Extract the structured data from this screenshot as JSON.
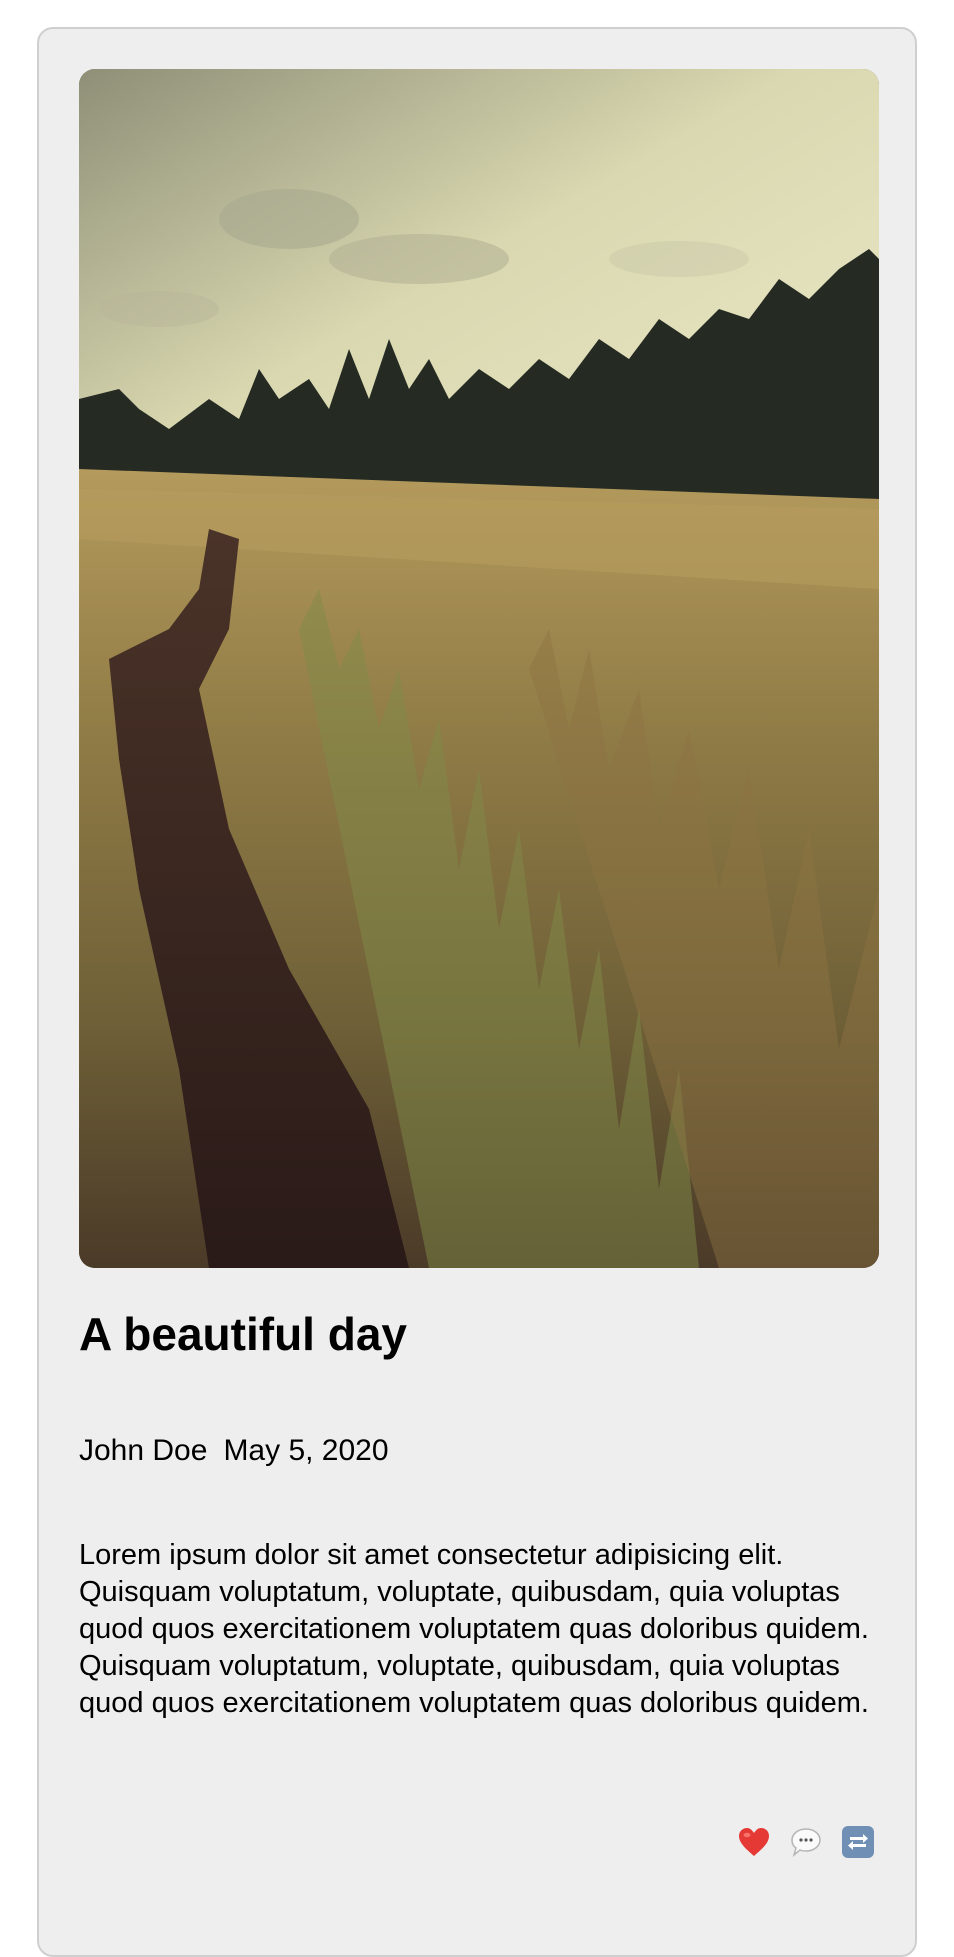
{
  "post": {
    "image_alt": "Grassy meadow with a dirt path and pine forest under a cloudy sky",
    "title": "A beautiful day",
    "author": "John Doe",
    "date": "May 5, 2020",
    "body": "Lorem ipsum dolor sit amet consectetur adipisicing elit. Quisquam voluptatum, voluptate, quibusdam, quia voluptas quod quos exercitationem voluptatem quas doloribus quidem. Quisquam voluptatum, voluptate, quibusdam, quia voluptas quod quos exercitationem voluptatem quas doloribus quidem."
  },
  "actions": {
    "like_icon": "heart-icon",
    "comment_icon": "speech-bubble-icon",
    "share_icon": "repeat-icon"
  },
  "colors": {
    "card_background": "#eeeeee",
    "heart": "#e53935",
    "repeat": "#6f8fb5"
  }
}
